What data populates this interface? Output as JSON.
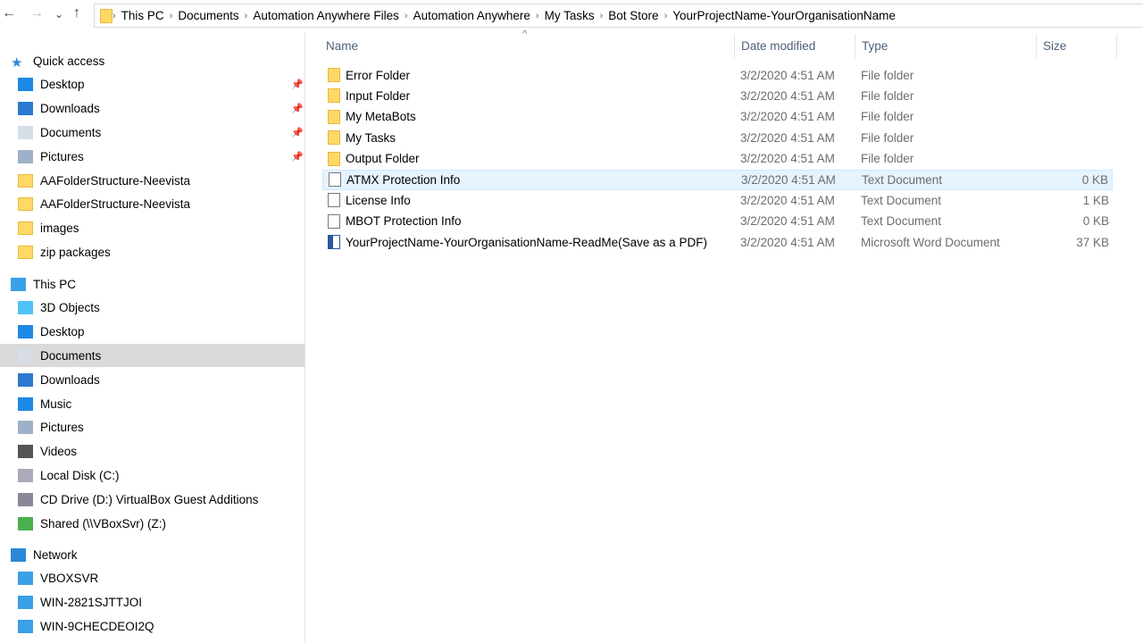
{
  "nav": {
    "back": "←",
    "forward": "→",
    "recent": "⌄",
    "up": "↑"
  },
  "breadcrumb": [
    "This PC",
    "Documents",
    "Automation Anywhere Files",
    "Automation Anywhere",
    "My Tasks",
    "Bot Store",
    "YourProjectName-YourOrganisationName"
  ],
  "sidebar": [
    {
      "label": "Quick access",
      "icon": "star-icon",
      "level": 0
    },
    {
      "label": "Desktop",
      "icon": "desktop-icon",
      "level": 1,
      "pinned": true
    },
    {
      "label": "Downloads",
      "icon": "download-icon",
      "level": 1,
      "pinned": true
    },
    {
      "label": "Documents",
      "icon": "documents-icon",
      "level": 1,
      "pinned": true
    },
    {
      "label": "Pictures",
      "icon": "pictures-icon",
      "level": 1,
      "pinned": true
    },
    {
      "label": "AAFolderStructure-Neevista",
      "icon": "folder-icon",
      "level": 1
    },
    {
      "label": "AAFolderStructure-Neevista",
      "icon": "folder-icon",
      "level": 1
    },
    {
      "label": "images",
      "icon": "folder-icon",
      "level": 1
    },
    {
      "label": "zip packages",
      "icon": "folder-icon",
      "level": 1
    },
    {
      "label": "This PC",
      "icon": "computer-icon",
      "level": 0
    },
    {
      "label": "3D Objects",
      "icon": "3d-objects-icon",
      "level": 1
    },
    {
      "label": "Desktop",
      "icon": "desktop-icon",
      "level": 1
    },
    {
      "label": "Documents",
      "icon": "documents-icon",
      "level": 1,
      "selected": true
    },
    {
      "label": "Downloads",
      "icon": "download-icon",
      "level": 1
    },
    {
      "label": "Music",
      "icon": "music-icon",
      "level": 1
    },
    {
      "label": "Pictures",
      "icon": "pictures-icon",
      "level": 1
    },
    {
      "label": "Videos",
      "icon": "videos-icon",
      "level": 1
    },
    {
      "label": "Local Disk (C:)",
      "icon": "disk-icon",
      "level": 1
    },
    {
      "label": "CD Drive (D:) VirtualBox Guest Additions",
      "icon": "cd-drive-icon",
      "level": 1
    },
    {
      "label": "Shared (\\\\VBoxSvr) (Z:)",
      "icon": "network-drive-icon",
      "level": 1
    },
    {
      "label": "Network",
      "icon": "network-icon",
      "level": 0
    },
    {
      "label": "VBOXSVR",
      "icon": "computer-icon",
      "level": 1
    },
    {
      "label": "WIN-2821SJTTJOI",
      "icon": "computer-icon",
      "level": 1
    },
    {
      "label": "WIN-9CHECDEOI2Q",
      "icon": "computer-icon",
      "level": 1
    }
  ],
  "columns": {
    "name": "Name",
    "date": "Date modified",
    "type": "Type",
    "size": "Size"
  },
  "files": [
    {
      "name": "Error Folder",
      "date": "3/2/2020 4:51 AM",
      "type": "File folder",
      "size": "",
      "icon": "folder-icon"
    },
    {
      "name": "Input Folder",
      "date": "3/2/2020 4:51 AM",
      "type": "File folder",
      "size": "",
      "icon": "folder-icon"
    },
    {
      "name": "My MetaBots",
      "date": "3/2/2020 4:51 AM",
      "type": "File folder",
      "size": "",
      "icon": "folder-icon"
    },
    {
      "name": "My Tasks",
      "date": "3/2/2020 4:51 AM",
      "type": "File folder",
      "size": "",
      "icon": "folder-icon"
    },
    {
      "name": "Output Folder",
      "date": "3/2/2020 4:51 AM",
      "type": "File folder",
      "size": "",
      "icon": "folder-icon"
    },
    {
      "name": "ATMX Protection Info",
      "date": "3/2/2020 4:51 AM",
      "type": "Text Document",
      "size": "0 KB",
      "icon": "text-file-icon",
      "selected": true
    },
    {
      "name": "License Info",
      "date": "3/2/2020 4:51 AM",
      "type": "Text Document",
      "size": "1 KB",
      "icon": "text-file-icon"
    },
    {
      "name": "MBOT Protection Info",
      "date": "3/2/2020 4:51 AM",
      "type": "Text Document",
      "size": "0 KB",
      "icon": "text-file-icon"
    },
    {
      "name": "YourProjectName-YourOrganisationName-ReadMe(Save as a PDF)",
      "date": "3/2/2020 4:51 AM",
      "type": "Microsoft Word Document",
      "size": "37 KB",
      "icon": "word-file-icon"
    }
  ]
}
